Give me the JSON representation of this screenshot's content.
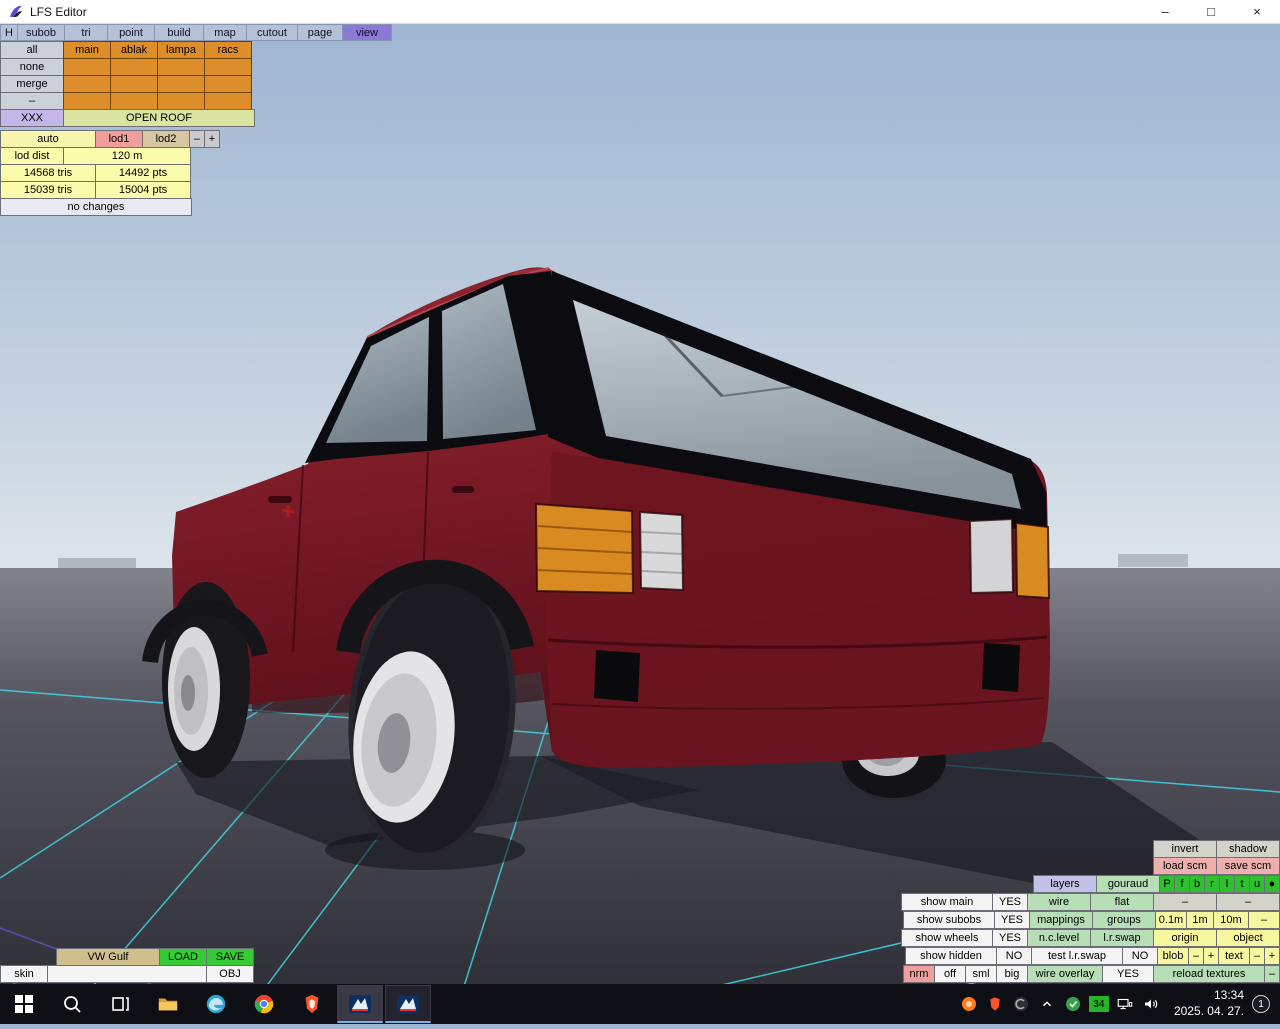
{
  "window": {
    "title": "LFS Editor",
    "minimize": "–",
    "maximize": "□",
    "close": "×"
  },
  "menu": {
    "items": [
      "H",
      "subob",
      "tri",
      "point",
      "build",
      "map",
      "cutout",
      "page",
      "view"
    ]
  },
  "subobj_panel": {
    "all": "all",
    "none": "none",
    "merge": "merge",
    "dash": "–",
    "xxx": "XXX",
    "open_roof": "OPEN ROOF",
    "groups": [
      "main",
      "ablak",
      "lampa",
      "racs"
    ]
  },
  "lod_panel": {
    "auto": "auto",
    "lod1": "lod1",
    "lod2": "lod2",
    "minus": "–",
    "plus": "+",
    "lod_dist_label": "lod dist",
    "lod_dist_value": "120 m",
    "tris_1": "14568 tris",
    "pts_1": "14492 pts",
    "tris_2": "15039 tris",
    "pts_2": "15004 pts",
    "status": "no changes"
  },
  "file_panel": {
    "vehicle": "VW Gulf",
    "load": "LOAD",
    "save": "SAVE",
    "skin": "skin",
    "skin_value": "",
    "obj": "OBJ"
  },
  "right_panel": {
    "invert": "invert",
    "shadow": "shadow",
    "load_scm": "load scm",
    "save_scm": "save scm",
    "layers": "layers",
    "gouraud": "gouraud",
    "proj": [
      "P",
      "f",
      "b",
      "r",
      "l",
      "t",
      "u",
      "●"
    ],
    "show_main": "show main",
    "show_main_val": "YES",
    "wire": "wire",
    "flat": "flat",
    "dash_a": "–",
    "dash_b": "–",
    "show_subobs": "show subobs",
    "show_subobs_val": "YES",
    "mappings": "mappings",
    "groups": "groups",
    "grid_small": "0.1m",
    "grid_mid": "1m",
    "grid_big": "10m",
    "grid_dash": "–",
    "show_wheels": "show wheels",
    "show_wheels_val": "YES",
    "nc_level": "n.c.level",
    "lr_swap": "l.r.swap",
    "origin": "origin",
    "object": "object",
    "show_hidden": "show hidden",
    "show_hidden_val": "NO",
    "test_lr_swap": "test l.r.swap",
    "test_lr_swap_val": "NO",
    "blob": "blob",
    "blob_minus": "–",
    "blob_plus": "+",
    "text": "text",
    "text_minus": "–",
    "text_plus": "+",
    "nrm": "nrm",
    "off": "off",
    "sml": "sml",
    "big": "big",
    "wire_overlay": "wire overlay",
    "wire_overlay_val": "YES",
    "reload_textures": "reload textures",
    "reload_dash": "–"
  },
  "taskbar": {
    "time": "13:34",
    "date": "2025. 04. 27.",
    "notification_count": "1",
    "temp_badge": "34",
    "icons": [
      "start",
      "search",
      "task-view",
      "file-explorer",
      "edge",
      "chrome",
      "brave",
      "lfs-active",
      "lfs",
      "tray-orange",
      "tray-brave",
      "tray-swirl",
      "chevron-up",
      "tray-green",
      "temp-badge",
      "network",
      "volume"
    ]
  },
  "colors": {
    "car_body": "#7a1a26",
    "panel_orange": "#dd8e2b",
    "grid_cyan": "#3fd6e8",
    "menu_active": "#8a7ad5"
  }
}
